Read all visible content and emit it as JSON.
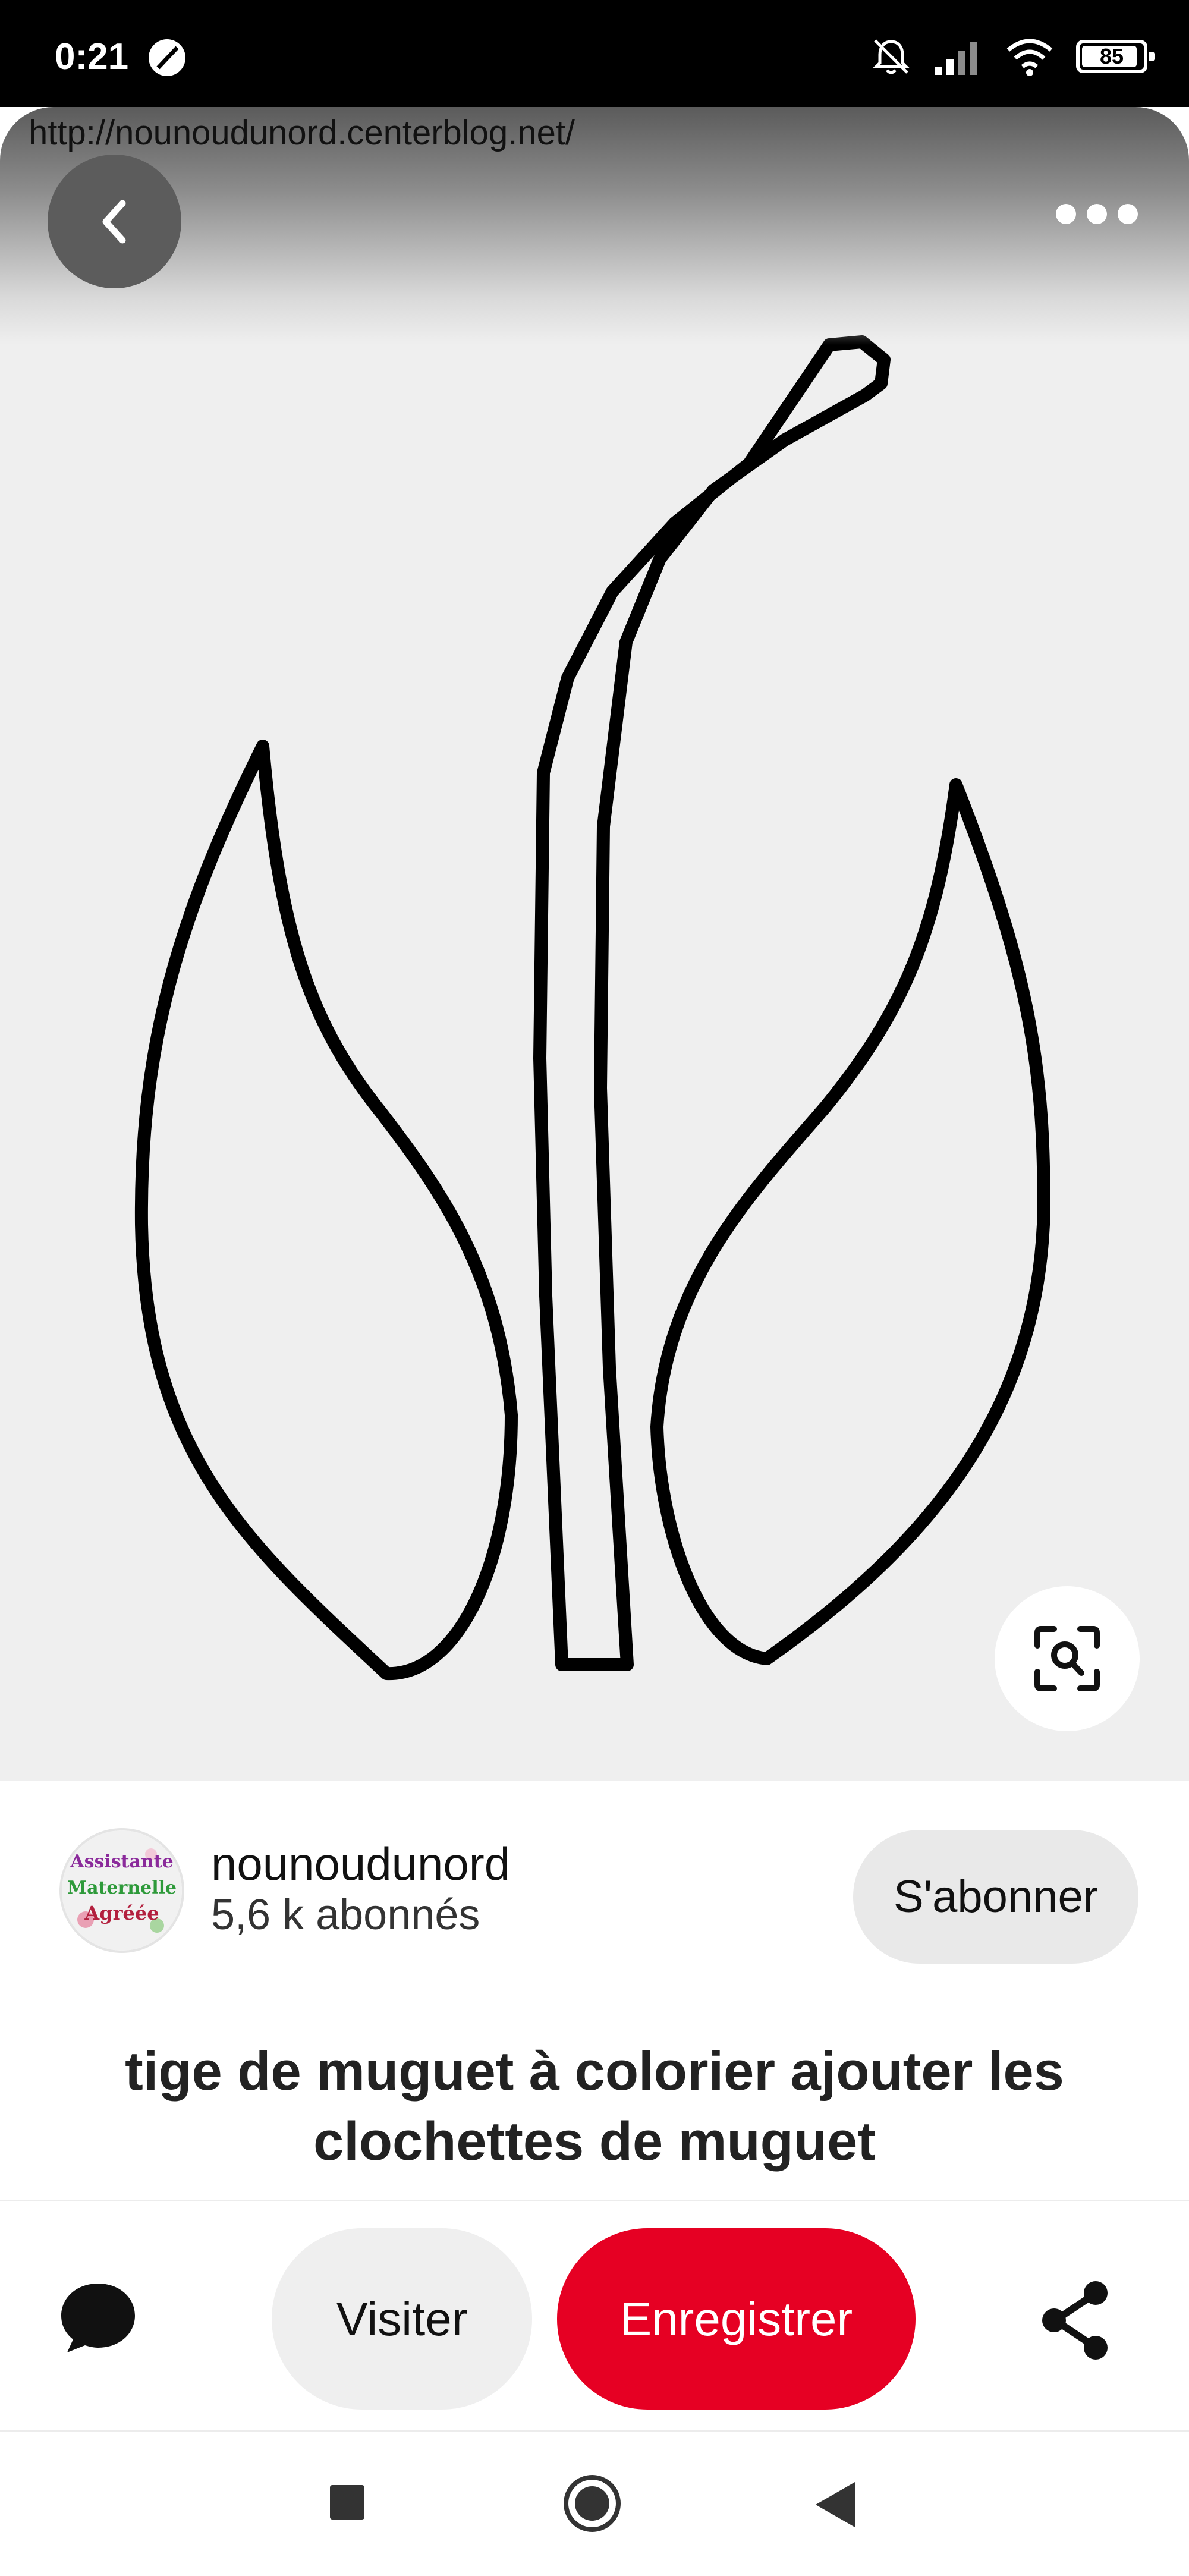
{
  "status_bar": {
    "time": "0:21",
    "battery": "85",
    "battery_level": 0.85,
    "icons": [
      "moon-icon",
      "bell-off-icon",
      "signal-icon",
      "wifi-icon",
      "battery-icon"
    ]
  },
  "pin": {
    "source_url": "http://nounoudunord.centerblog.net/",
    "icons": {
      "back": "chevron-left-icon",
      "more": "more-dots-icon",
      "lens": "visual-search-icon"
    }
  },
  "creator": {
    "name": "nounoudunord",
    "followers": "5,6 k abonnés",
    "follow_label": "S'abonner",
    "avatar_lines": [
      "Assistante",
      "Maternelle",
      "Agréée"
    ]
  },
  "title": "tige de muguet à colorier ajouter les clochettes de  muguet",
  "actions": {
    "visit_label": "Visiter",
    "save_label": "Enregistrer",
    "icons": {
      "comment": "comment-icon",
      "share": "share-icon"
    }
  },
  "colors": {
    "save_red": "#e60023",
    "image_background": "#efefef"
  },
  "nav": {
    "icons": [
      "recents-square-icon",
      "home-circle-icon",
      "back-triangle-icon"
    ]
  }
}
